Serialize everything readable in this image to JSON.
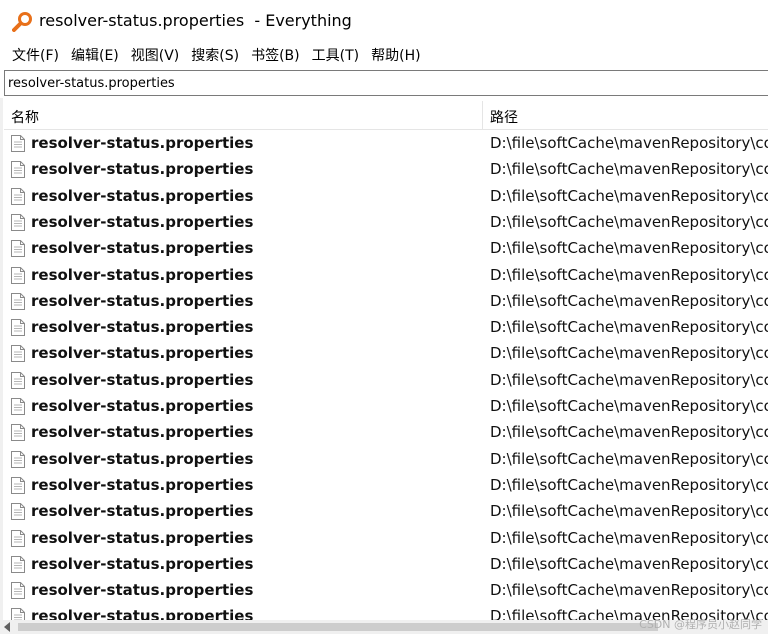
{
  "window": {
    "title": "resolver-status.properties  - Everything"
  },
  "menu": [
    {
      "label": "文件(F)"
    },
    {
      "label": "编辑(E)"
    },
    {
      "label": "视图(V)"
    },
    {
      "label": "搜索(S)"
    },
    {
      "label": "书签(B)"
    },
    {
      "label": "工具(T)"
    },
    {
      "label": "帮助(H)"
    }
  ],
  "search": {
    "value": "resolver-status.properties"
  },
  "columns": {
    "name": "名称",
    "path": "路径"
  },
  "results": [
    {
      "name": "resolver-status.properties",
      "path": "D:\\file\\softCache\\mavenRepository\\co"
    },
    {
      "name": "resolver-status.properties",
      "path": "D:\\file\\softCache\\mavenRepository\\co"
    },
    {
      "name": "resolver-status.properties",
      "path": "D:\\file\\softCache\\mavenRepository\\co"
    },
    {
      "name": "resolver-status.properties",
      "path": "D:\\file\\softCache\\mavenRepository\\co"
    },
    {
      "name": "resolver-status.properties",
      "path": "D:\\file\\softCache\\mavenRepository\\co"
    },
    {
      "name": "resolver-status.properties",
      "path": "D:\\file\\softCache\\mavenRepository\\co"
    },
    {
      "name": "resolver-status.properties",
      "path": "D:\\file\\softCache\\mavenRepository\\co"
    },
    {
      "name": "resolver-status.properties",
      "path": "D:\\file\\softCache\\mavenRepository\\co"
    },
    {
      "name": "resolver-status.properties",
      "path": "D:\\file\\softCache\\mavenRepository\\co"
    },
    {
      "name": "resolver-status.properties",
      "path": "D:\\file\\softCache\\mavenRepository\\co"
    },
    {
      "name": "resolver-status.properties",
      "path": "D:\\file\\softCache\\mavenRepository\\co"
    },
    {
      "name": "resolver-status.properties",
      "path": "D:\\file\\softCache\\mavenRepository\\co"
    },
    {
      "name": "resolver-status.properties",
      "path": "D:\\file\\softCache\\mavenRepository\\co"
    },
    {
      "name": "resolver-status.properties",
      "path": "D:\\file\\softCache\\mavenRepository\\co"
    },
    {
      "name": "resolver-status.properties",
      "path": "D:\\file\\softCache\\mavenRepository\\co"
    },
    {
      "name": "resolver-status.properties",
      "path": "D:\\file\\softCache\\mavenRepository\\co"
    },
    {
      "name": "resolver-status.properties",
      "path": "D:\\file\\softCache\\mavenRepository\\co"
    },
    {
      "name": "resolver-status.properties",
      "path": "D:\\file\\softCache\\mavenRepository\\co"
    },
    {
      "name": "resolver-status.properties",
      "path": "D:\\file\\softCache\\mavenRepository\\co"
    }
  ],
  "watermark": "CSDN @程序员小赵同学",
  "icons": {
    "app": "magnifier-icon",
    "file": "document-icon"
  },
  "colors": {
    "app_icon": "#e8701a"
  }
}
